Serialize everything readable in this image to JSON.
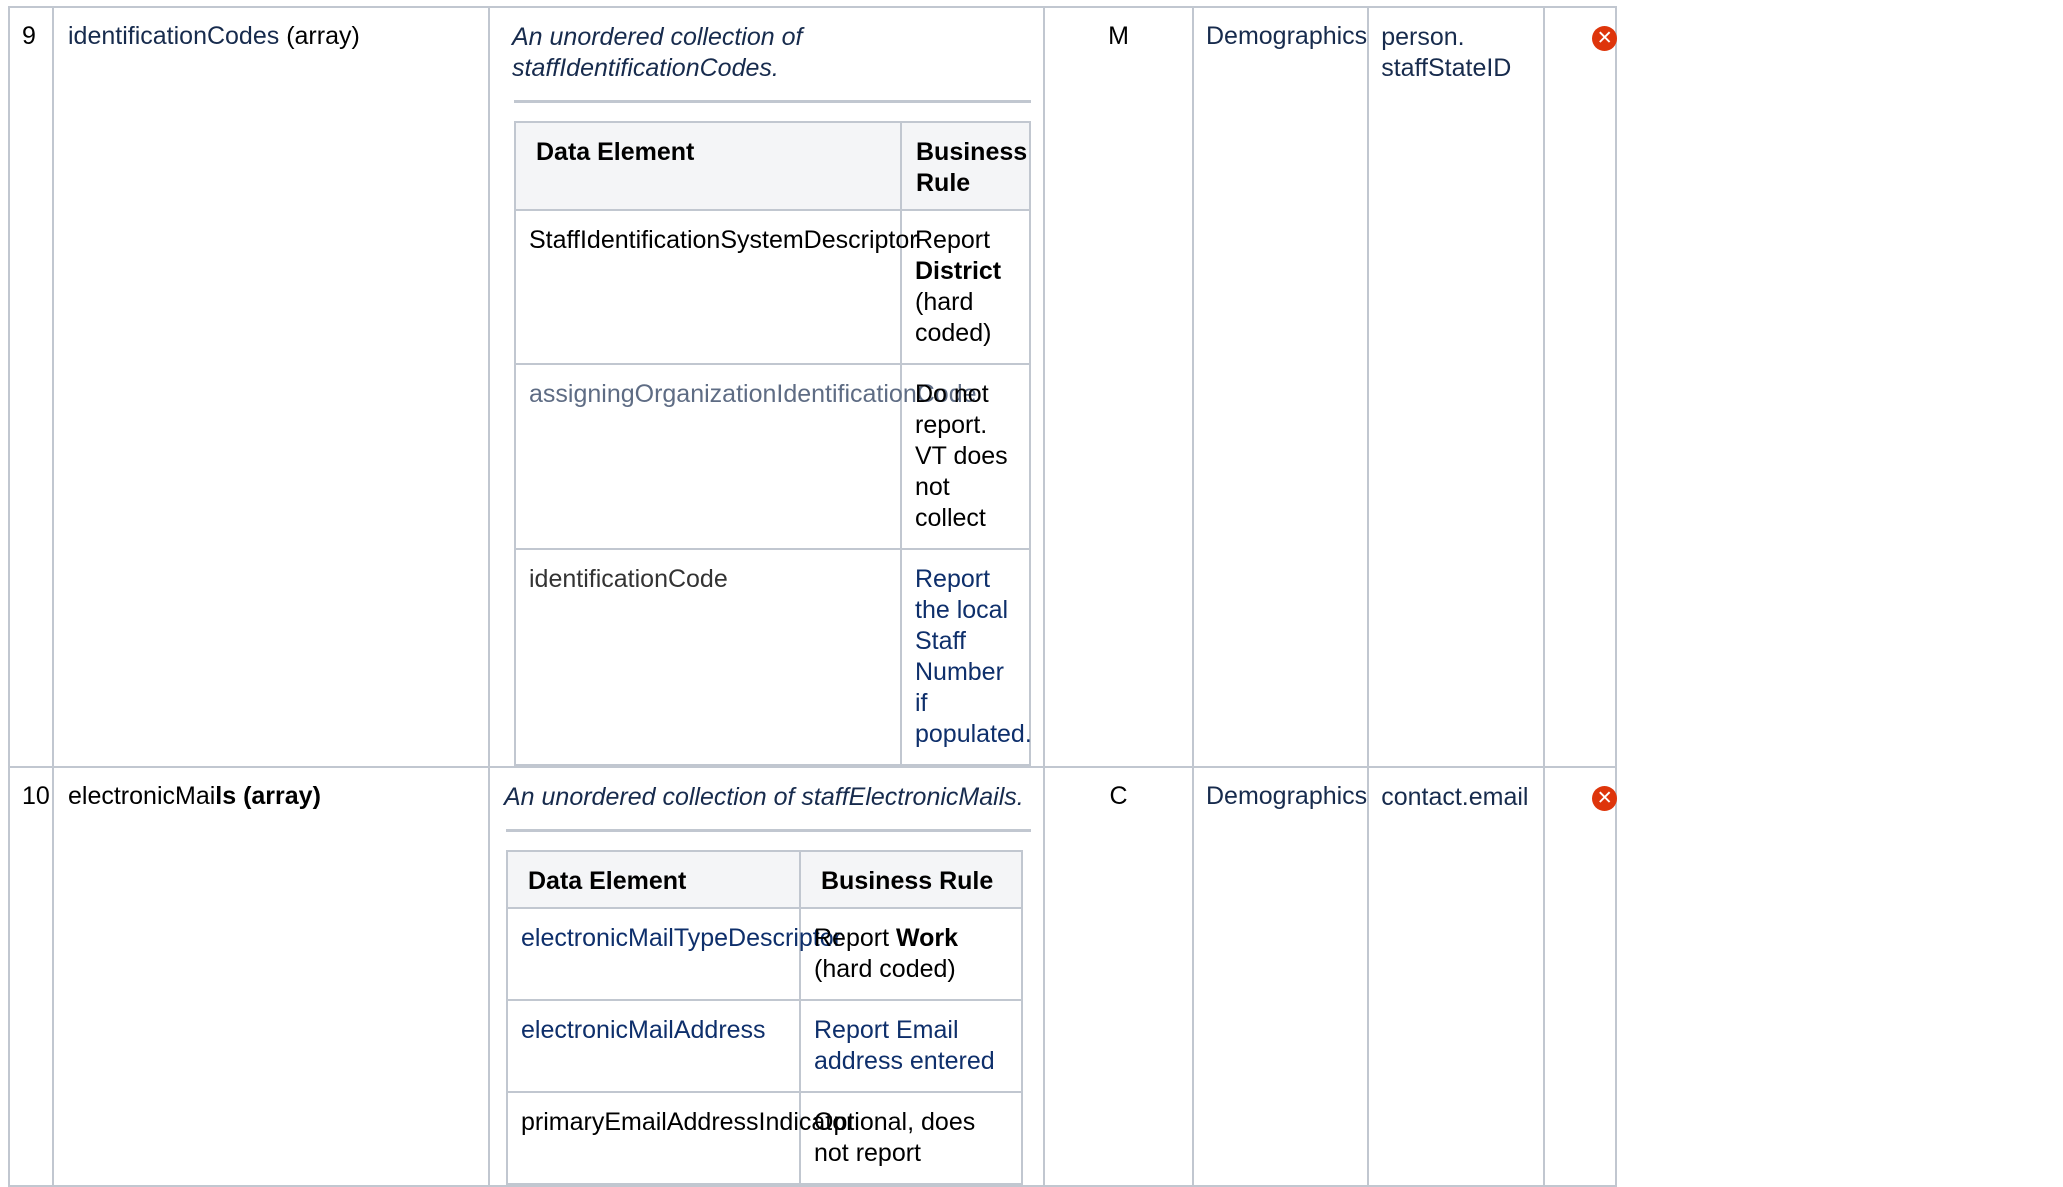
{
  "rows": [
    {
      "number": "9",
      "element_name": "identificationCodes",
      "element_suffix": " (array)",
      "description": "An unordered collection of staffIdentificationCodes.",
      "requirement": "M",
      "category": "Demographics",
      "mapping_line1": "person.",
      "mapping_line2": "staffStateID",
      "status_icon": "error-x-icon",
      "headers": {
        "data_element": "Data Element",
        "business_rule_line1": "Business",
        "business_rule_line2": "Rule"
      },
      "sub_rows": [
        {
          "element": "StaffIdentificationSystemDescriptor",
          "rule_before": "Report",
          "rule_bold": "District",
          "rule_after": "(hard coded)"
        },
        {
          "element": "assigningOrganizationIdentificationCode",
          "rule": "Do not report. VT does not collect"
        },
        {
          "element": "identificationCode",
          "rule": "Report the local Staff Number if populated."
        }
      ]
    },
    {
      "number": "10",
      "element_name_plain": "electronicMai",
      "element_name_bold": "ls (array)",
      "description": "An unordered collection of staffElectronicMails.",
      "requirement": "C",
      "category": "Demographics",
      "mapping": "contact.email",
      "status_icon": "error-x-icon",
      "headers": {
        "data_element": "Data Element",
        "business_rule": "Business Rule"
      },
      "sub_rows": [
        {
          "element": "electronicMailTypeDescriptor",
          "rule_before": "Report ",
          "rule_bold": "Work",
          "rule_after": " (hard coded)"
        },
        {
          "element": "electronicMailAddress",
          "rule": "Report Email address entered"
        },
        {
          "element": "primaryEmailAddressIndicator",
          "rule": "Optional, does not report"
        }
      ]
    }
  ],
  "colors": {
    "border": "#c1c7d0",
    "header_bg": "#f4f5f7",
    "error": "#de350b",
    "link_text": "#172b4d"
  }
}
